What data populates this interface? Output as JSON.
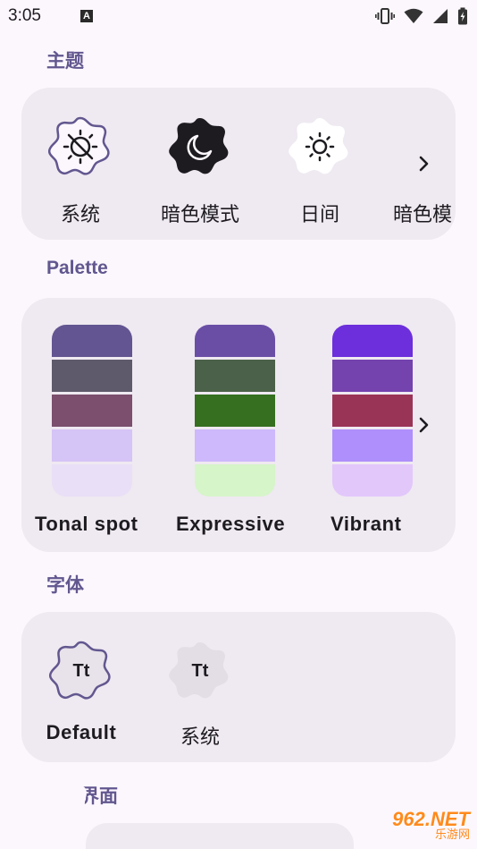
{
  "status": {
    "time": "3:05",
    "notif_glyph": "A"
  },
  "sections": {
    "theme": "主题",
    "palette": "Palette",
    "font": "字体",
    "interface": "界面"
  },
  "themes": [
    {
      "label": "系统",
      "icon": "auto-brightness-icon",
      "selected": true
    },
    {
      "label": "暗色模式",
      "icon": "moon-icon",
      "selected": false
    },
    {
      "label": "日间",
      "icon": "sun-icon",
      "selected": false
    },
    {
      "label": "暗色模",
      "icon": "",
      "selected": false
    }
  ],
  "palettes": [
    {
      "label": "Tonal spot",
      "colors": [
        "#625591",
        "#5f5a6b",
        "#7b4f6d",
        "#d5c4f6",
        "#e9dff7"
      ]
    },
    {
      "label": "Expressive",
      "colors": [
        "#6a4ea6",
        "#4b6149",
        "#366f20",
        "#cdb9fb",
        "#d6f5c9"
      ]
    },
    {
      "label": "Vibrant",
      "colors": [
        "#6c2fdb",
        "#7443ad",
        "#9a3456",
        "#ae8ffb",
        "#e2c7fb"
      ]
    }
  ],
  "fonts": [
    {
      "label": "Default",
      "badge": "Tt",
      "selected": true
    },
    {
      "label": "系统",
      "badge": "Tt",
      "selected": false
    }
  ],
  "watermark": {
    "brand": "962.NET",
    "sub": "乐游网"
  },
  "colors": {
    "accent": "#62578f",
    "card": "#efe9f1",
    "background": "#fcf7fd"
  }
}
